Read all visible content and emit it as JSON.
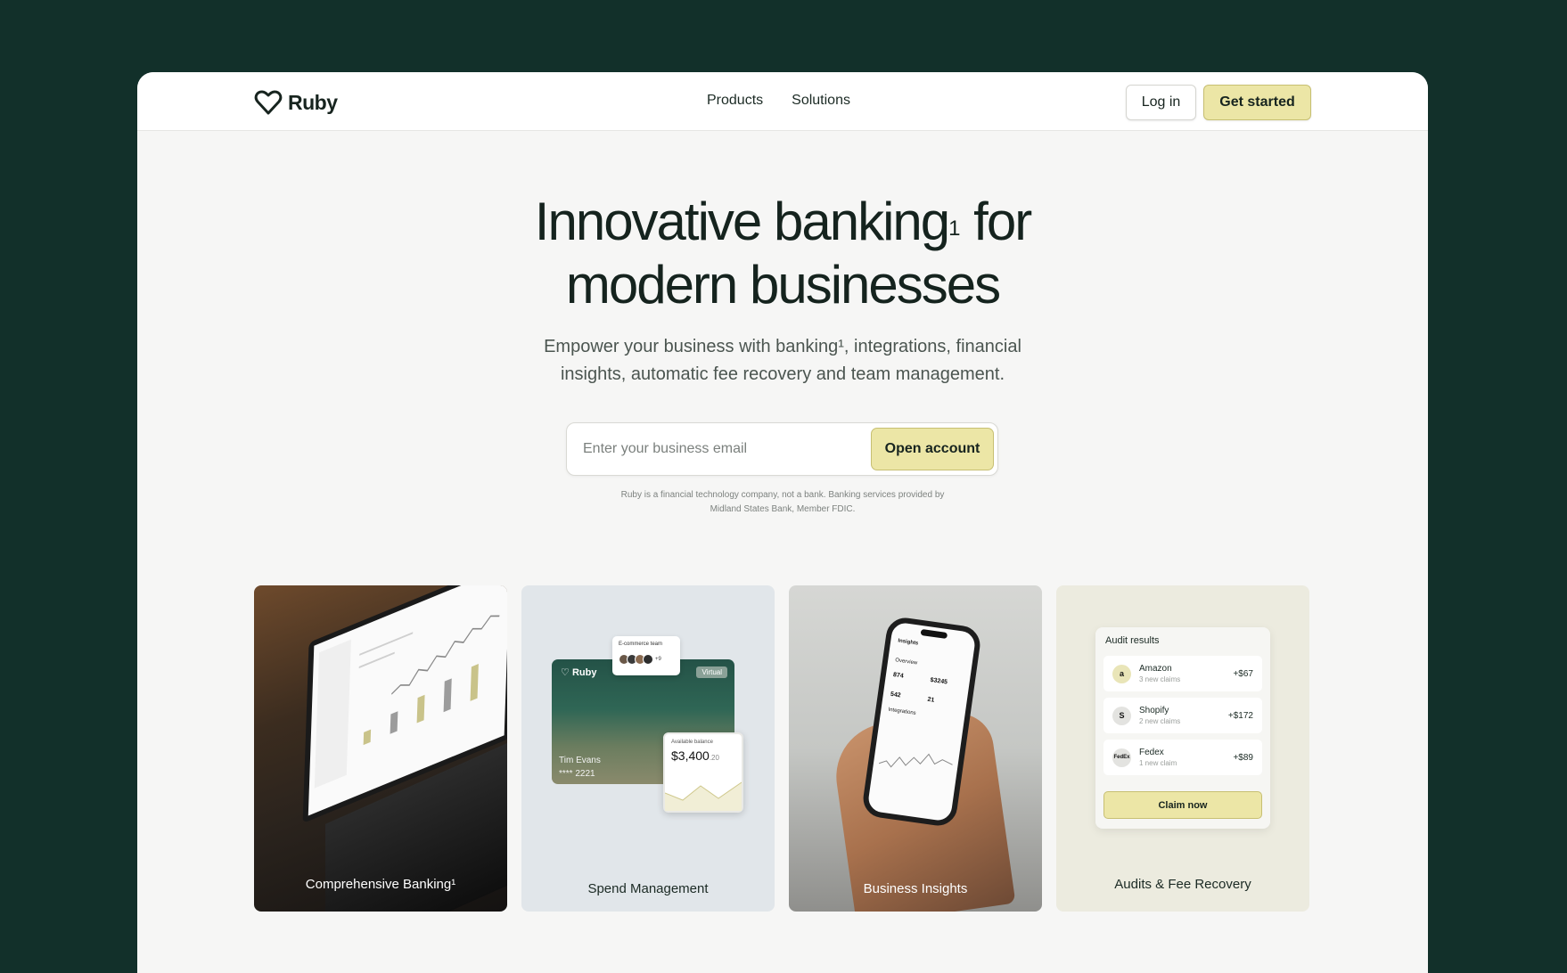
{
  "nav": {
    "brand": "Ruby",
    "links": [
      "Products",
      "Solutions"
    ],
    "login": "Log in",
    "get_started": "Get started"
  },
  "hero": {
    "title_line1": "Innovative banking",
    "title_sup": "1",
    "title_line1_end": " for",
    "title_line2": "modern businesses",
    "subtitle": "Empower your business with banking¹, integrations, financial insights, automatic fee recovery and team management.",
    "email_placeholder": "Enter your business email",
    "open_account": "Open account",
    "disclaimer": "Ruby is a financial technology company, not a bank. Banking services provided by Midland States Bank, Member FDIC."
  },
  "cards": [
    {
      "label": "Comprehensive Banking¹"
    },
    {
      "label": "Spend Management",
      "team_title": "E-commerce team",
      "team_more": "+9",
      "card_brand": "Ruby",
      "card_tag": "Virtual",
      "card_holder": "Tim Evans",
      "card_number": "**** 2221",
      "balance_title": "Available balance",
      "balance_value": "$3,400",
      "balance_cents": ".20"
    },
    {
      "label": "Business Insights",
      "phone_title": "Insights",
      "phone_overview": "Overview",
      "phone_v1": "874",
      "phone_v2": "$3245",
      "phone_v3": "542",
      "phone_v4": "21",
      "phone_integrations": "Integrations"
    },
    {
      "label": "Audits & Fee Recovery",
      "audit_title": "Audit results",
      "rows": [
        {
          "icon": "a",
          "name": "Amazon",
          "sub": "3 new claims",
          "amount": "+$67"
        },
        {
          "icon": "S",
          "name": "Shopify",
          "sub": "2 new claims",
          "amount": "+$172"
        },
        {
          "icon": "FedEx",
          "name": "Fedex",
          "sub": "1 new claim",
          "amount": "+$89"
        }
      ],
      "claim": "Claim now"
    }
  ],
  "colors": {
    "background": "#12302a",
    "accent": "#ece6a6",
    "text": "#17241f"
  }
}
